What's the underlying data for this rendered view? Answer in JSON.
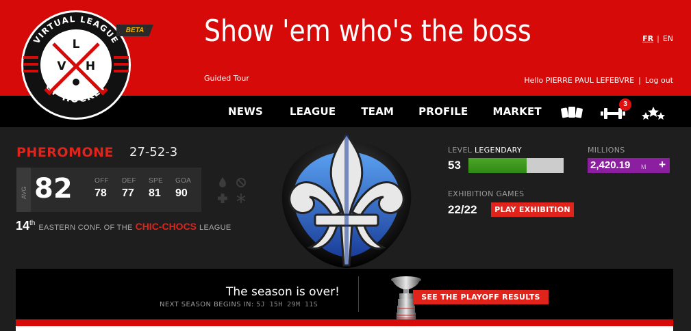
{
  "header": {
    "slogan": "Show 'em who's the boss",
    "guided_tour": "Guided Tour",
    "lang_fr": "FR",
    "lang_sep": "|",
    "lang_en": "EN",
    "greeting": "Hello PIERRE PAUL LEFEBVRE",
    "logout_sep": "|",
    "logout": "Log out"
  },
  "logo": {
    "top_text": "VIRTUAL LEAGUE",
    "bottom_text": "OF HOCKEY",
    "letter_v": "V",
    "letter_l": "L",
    "letter_h": "H",
    "beta": "BETA"
  },
  "nav": {
    "items": [
      "NEWS",
      "LEAGUE",
      "TEAM",
      "PROFILE",
      "MARKET"
    ],
    "training_badge": "3",
    "icons": [
      "cards-icon",
      "dumbbell-icon",
      "stars-icon"
    ]
  },
  "team": {
    "name": "PHEROMONE",
    "record": "27-52-3",
    "avg_label": "AVG",
    "avg_value": "82",
    "stats": [
      {
        "label": "OFF",
        "value": "78"
      },
      {
        "label": "DEF",
        "value": "77"
      },
      {
        "label": "SPE",
        "value": "81"
      },
      {
        "label": "GOA",
        "value": "90"
      }
    ],
    "rank": "14",
    "rank_suffix": "th",
    "rank_text": "EASTERN CONF. OF THE",
    "league_name": "CHIC-CHOCS",
    "league_suffix": "LEAGUE"
  },
  "level": {
    "label": "LEVEL",
    "name": "LEGENDARY",
    "value": "53",
    "progress_fraction": 0.61
  },
  "millions": {
    "label": "MILLIONS",
    "value": "2,420.19",
    "unit": "M",
    "add": "+"
  },
  "exhibition": {
    "label": "EXHIBITION GAMES",
    "value": "22/22",
    "button": "PLAY EXHIBITION"
  },
  "season": {
    "title": "The season is over!",
    "next_label": "NEXT SEASON BEGINS IN:",
    "countdown": "5J 15H 29M 11S",
    "playoff_button": "SEE THE PLAYOFF RESULTS"
  },
  "colors": {
    "brand_red": "#d70a0a",
    "accent_red": "#e0231b",
    "level_green": "#3e9a1f",
    "millions_purple": "#8b1fa0"
  }
}
